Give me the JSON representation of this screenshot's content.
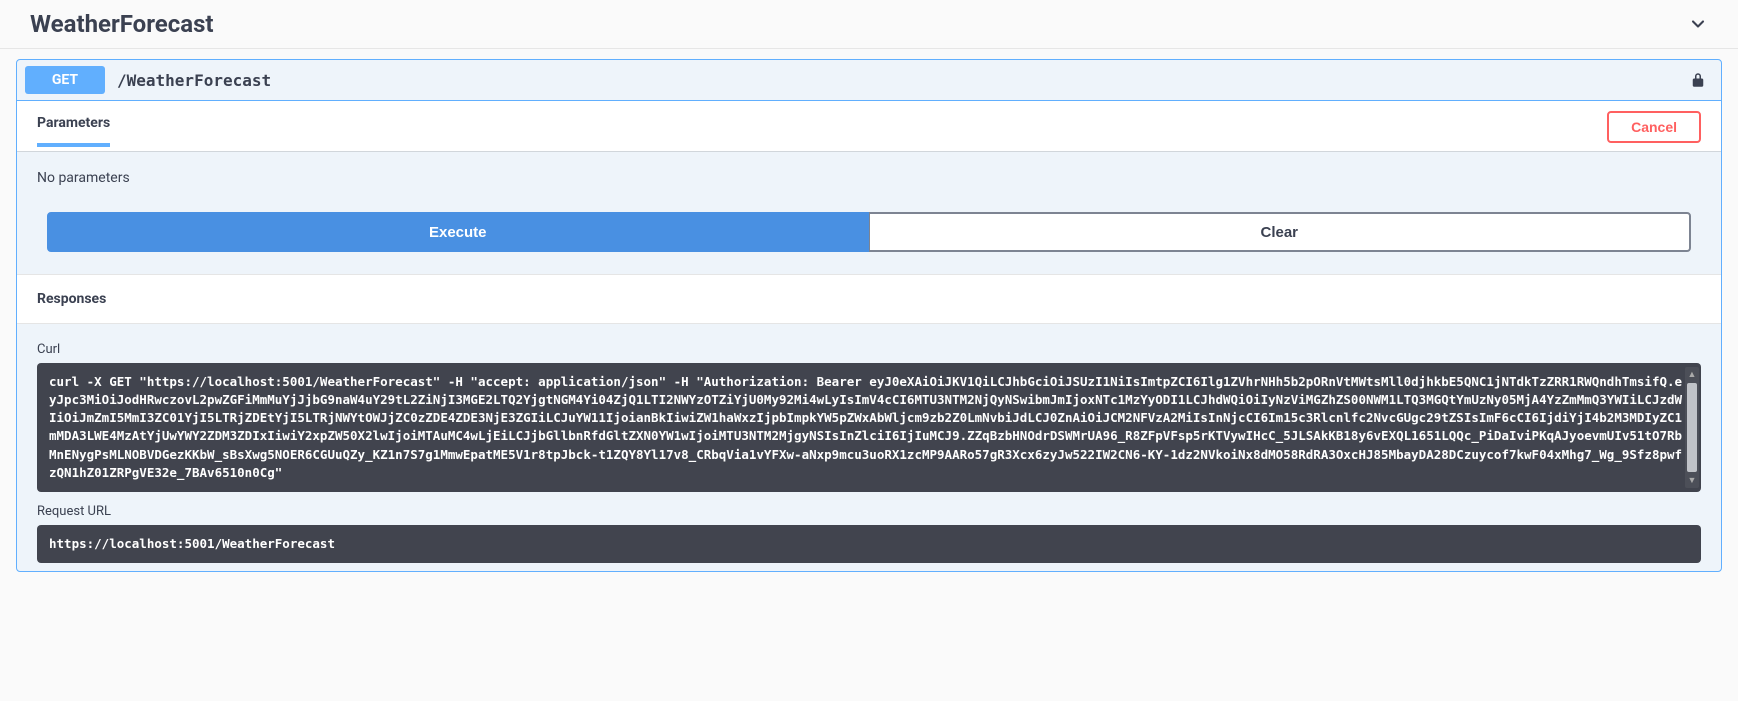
{
  "section": {
    "title": "WeatherForecast"
  },
  "opblock": {
    "method": "GET",
    "path": "/WeatherForecast"
  },
  "tabs": {
    "parameters_label": "Parameters",
    "cancel_label": "Cancel"
  },
  "params": {
    "no_params_text": "No parameters"
  },
  "actions": {
    "execute_label": "Execute",
    "clear_label": "Clear"
  },
  "responses": {
    "heading": "Responses",
    "curl_label": "Curl",
    "curl_value": "curl -X GET \"https://localhost:5001/WeatherForecast\" -H \"accept: application/json\" -H \"Authorization: Bearer eyJ0eXAiOiJKV1QiLCJhbGciOiJSUzI1NiIsImtpZCI6Ilg1ZVhrNHh5b2pORnVtMWtsMll0djhkbE5QNC1jNTdkTzZRR1RWQndhTmsifQ.eyJpc3MiOiJodHRwczovL2pwZGFiMmMuYjJjbG9naW4uY29tL2ZiNjI3MGE2LTQ2YjgtNGM4Yi04ZjQ1LTI2NWYzOTZiYjU0My92Mi4wLyIsImV4cCI6MTU3NTM2NjQyNSwibmJmIjoxNTc1MzYyODI1LCJhdWQiOiIyNzViMGZhZS00NWM1LTQ3MGQtYmUzNy05MjA4YzZmMmQ3YWIiLCJzdWIiOiJmZmI5MmI3ZC01YjI5LTRjZDEtYjI5LTRjNWYtOWJjZC0zZDE4ZDE3NjE3ZGIiLCJuYW11IjoianBkIiwiZW1haWxzIjpbImpkYW5pZWxAbWljcm9zb2Z0LmNvbiJdLCJ0ZnAiOiJCM2NFVzA2MiIsInNjcCI6Im15c3Rlcnlfc2NvcGUgc29tZSIsImF6cCI6IjdiYjI4b2M3MDIyZC1mMDA3LWE4MzAtYjUwYWY2ZDM3ZDIxIiwiY2xpZW50X2lwIjoiMTAuMC4wLjEiLCJjbGllbnRfdGltZXN0YW1wIjoiMTU3NTM2MjgyNSIsInZlciI6IjIuMCJ9.ZZqBzbHNOdrDSWMrUA96_R8ZFpVFsp5rKTVywIHcC_5JLSAkKB18y6vEXQL1651LQQc_PiDaIviPKqAJyoevmUIv51tO7RbMnENygPsMLNOBVDGezKKbW_sBsXwg5NOER6CGUuQZy_KZ1n7S7g1MmwEpatME5V1r8tpJbck-t1ZQY8Yl17v8_CRbqVia1vYFXw-aNxp9mcu3uoRX1zcMP9AARo57gR3Xcx6zyJw522IW2CN6-KY-1dz2NVkoiNx8dMO58RdRA3OxcHJ85MbayDA28DCzuycof7kwF04xMhg7_Wg_9Sfz8pwfzQN1hZ01ZRPgVE32e_7BAv6510n0Cg\"",
    "request_url_label": "Request URL",
    "request_url_value": "https://localhost:5001/WeatherForecast"
  }
}
